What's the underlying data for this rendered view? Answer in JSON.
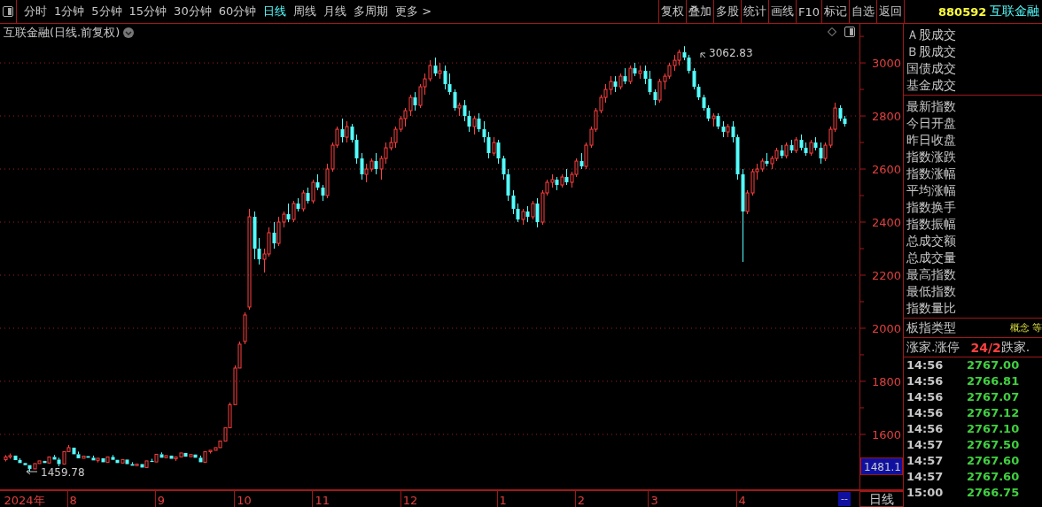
{
  "toolbar": {
    "periods": [
      {
        "label": "分时",
        "selected": false
      },
      {
        "label": "1分钟",
        "selected": false
      },
      {
        "label": "5分钟",
        "selected": false
      },
      {
        "label": "15分钟",
        "selected": false
      },
      {
        "label": "30分钟",
        "selected": false
      },
      {
        "label": "60分钟",
        "selected": false
      },
      {
        "label": "日线",
        "selected": true
      },
      {
        "label": "周线",
        "selected": false
      },
      {
        "label": "月线",
        "selected": false
      },
      {
        "label": "多周期",
        "selected": false
      },
      {
        "label": "更多 >",
        "selected": false
      }
    ],
    "buttons": [
      "复权",
      "叠加",
      "多股",
      "统计",
      "画线",
      "F10",
      "标记",
      "自选",
      "返回"
    ]
  },
  "quote": {
    "code": "880592",
    "name": "互联金融"
  },
  "chart": {
    "title": "互联金融(日线.前复权)",
    "high_label": "3062.83",
    "low_label": "1459.78",
    "last_price": "1481.1",
    "scroll_marker": "--",
    "period_button": "日线",
    "chart_data": {
      "type": "candlestick",
      "ylim": [
        1393,
        3147
      ],
      "grid": true,
      "categories": [
        null,
        null,
        null,
        null,
        "2024年",
        null,
        null,
        null,
        null,
        null,
        null,
        null,
        null,
        null,
        "8",
        null,
        null,
        null,
        null,
        null,
        null,
        null,
        null,
        null,
        null,
        null,
        null,
        null,
        null,
        null,
        null,
        null,
        "9",
        null,
        null,
        null,
        null,
        null,
        null,
        null,
        null,
        null,
        null,
        null,
        null,
        null,
        null,
        null,
        null,
        "10",
        null,
        null,
        null,
        null,
        null,
        null,
        null,
        null,
        null,
        null,
        null,
        null,
        null,
        null,
        null,
        "11",
        null,
        null,
        null,
        null,
        null,
        null,
        null,
        null,
        null,
        null,
        null,
        null,
        null,
        null,
        null,
        null,
        null,
        "12",
        null,
        null,
        null,
        null,
        null,
        null,
        null,
        null,
        null,
        null,
        null,
        null,
        null,
        null,
        null,
        null,
        null,
        null,
        "1",
        null,
        null,
        null,
        null,
        null,
        null,
        null,
        null,
        null,
        null,
        null,
        null,
        null,
        null,
        null,
        "2",
        null,
        null,
        null,
        null,
        null,
        null,
        null,
        null,
        null,
        null,
        null,
        null,
        null,
        null,
        "3",
        null,
        null,
        null,
        null,
        null,
        null,
        null,
        null,
        null,
        null,
        null,
        null,
        null,
        null,
        null,
        null,
        null,
        "4",
        null,
        null,
        null,
        null,
        null,
        null,
        null,
        null,
        null,
        null,
        null,
        null,
        null,
        null,
        null,
        null,
        null,
        null,
        null,
        null,
        null
      ],
      "yticks": [
        3000,
        2800,
        2600,
        2400,
        2200,
        2000,
        1800,
        1600
      ],
      "ohlc": [
        [
          1505,
          1522,
          1498,
          1515
        ],
        [
          1515,
          1528,
          1508,
          1520
        ],
        [
          1520,
          1524,
          1500,
          1503
        ],
        [
          1503,
          1510,
          1488,
          1492
        ],
        [
          1492,
          1498,
          1478,
          1484
        ],
        [
          1484,
          1490,
          1459,
          1470
        ],
        [
          1470,
          1495,
          1466,
          1490
        ],
        [
          1490,
          1504,
          1485,
          1500
        ],
        [
          1500,
          1506,
          1488,
          1492
        ],
        [
          1492,
          1520,
          1490,
          1515
        ],
        [
          1515,
          1522,
          1500,
          1505
        ],
        [
          1505,
          1512,
          1480,
          1488
        ],
        [
          1488,
          1540,
          1486,
          1535
        ],
        [
          1535,
          1560,
          1530,
          1550
        ],
        [
          1550,
          1556,
          1520,
          1525
        ],
        [
          1525,
          1535,
          1505,
          1510
        ],
        [
          1510,
          1522,
          1506,
          1518
        ],
        [
          1518,
          1524,
          1508,
          1512
        ],
        [
          1512,
          1520,
          1498,
          1502
        ],
        [
          1502,
          1515,
          1494,
          1510
        ],
        [
          1510,
          1514,
          1490,
          1495
        ],
        [
          1495,
          1520,
          1492,
          1515
        ],
        [
          1515,
          1522,
          1500,
          1504
        ],
        [
          1504,
          1510,
          1488,
          1492
        ],
        [
          1492,
          1508,
          1490,
          1505
        ],
        [
          1505,
          1510,
          1486,
          1488
        ],
        [
          1488,
          1495,
          1478,
          1482
        ],
        [
          1482,
          1492,
          1476,
          1488
        ],
        [
          1488,
          1494,
          1470,
          1475
        ],
        [
          1475,
          1505,
          1472,
          1500
        ],
        [
          1500,
          1508,
          1492,
          1496
        ],
        [
          1496,
          1530,
          1494,
          1525
        ],
        [
          1525,
          1532,
          1510,
          1512
        ],
        [
          1512,
          1524,
          1508,
          1520
        ],
        [
          1520,
          1524,
          1505,
          1508
        ],
        [
          1508,
          1520,
          1500,
          1515
        ],
        [
          1515,
          1535,
          1510,
          1530
        ],
        [
          1530,
          1536,
          1512,
          1516
        ],
        [
          1516,
          1528,
          1512,
          1524
        ],
        [
          1524,
          1528,
          1508,
          1512
        ],
        [
          1512,
          1520,
          1490,
          1495
        ],
        [
          1495,
          1540,
          1492,
          1535
        ],
        [
          1535,
          1545,
          1528,
          1540
        ],
        [
          1540,
          1556,
          1536,
          1550
        ],
        [
          1550,
          1580,
          1548,
          1575
        ],
        [
          1575,
          1630,
          1572,
          1625
        ],
        [
          1625,
          1720,
          1620,
          1712
        ],
        [
          1712,
          1860,
          1708,
          1850
        ],
        [
          1850,
          1950,
          1845,
          1940
        ],
        [
          1950,
          2060,
          1940,
          2050
        ],
        [
          2080,
          2450,
          2070,
          2420
        ],
        [
          2420,
          2440,
          2260,
          2300
        ],
        [
          2300,
          2340,
          2240,
          2260
        ],
        [
          2260,
          2300,
          2210,
          2280
        ],
        [
          2280,
          2380,
          2270,
          2360
        ],
        [
          2360,
          2400,
          2300,
          2320
        ],
        [
          2320,
          2420,
          2310,
          2400
        ],
        [
          2400,
          2440,
          2380,
          2430
        ],
        [
          2430,
          2470,
          2400,
          2410
        ],
        [
          2410,
          2480,
          2400,
          2470
        ],
        [
          2470,
          2490,
          2440,
          2450
        ],
        [
          2450,
          2520,
          2440,
          2510
        ],
        [
          2510,
          2530,
          2470,
          2480
        ],
        [
          2480,
          2560,
          2470,
          2550
        ],
        [
          2550,
          2580,
          2520,
          2530
        ],
        [
          2530,
          2540,
          2480,
          2500
        ],
        [
          2500,
          2620,
          2490,
          2600
        ],
        [
          2600,
          2700,
          2590,
          2690
        ],
        [
          2690,
          2760,
          2680,
          2750
        ],
        [
          2750,
          2790,
          2700,
          2720
        ],
        [
          2720,
          2780,
          2700,
          2760
        ],
        [
          2760,
          2770,
          2700,
          2710
        ],
        [
          2710,
          2730,
          2620,
          2640
        ],
        [
          2640,
          2660,
          2560,
          2580
        ],
        [
          2580,
          2620,
          2550,
          2600
        ],
        [
          2600,
          2640,
          2590,
          2630
        ],
        [
          2630,
          2660,
          2580,
          2600
        ],
        [
          2600,
          2650,
          2560,
          2640
        ],
        [
          2640,
          2700,
          2620,
          2680
        ],
        [
          2680,
          2720,
          2670,
          2700
        ],
        [
          2700,
          2760,
          2680,
          2750
        ],
        [
          2750,
          2800,
          2740,
          2790
        ],
        [
          2790,
          2830,
          2760,
          2820
        ],
        [
          2820,
          2880,
          2800,
          2870
        ],
        [
          2870,
          2890,
          2820,
          2840
        ],
        [
          2840,
          2920,
          2830,
          2910
        ],
        [
          2910,
          2960,
          2880,
          2940
        ],
        [
          2940,
          3010,
          2930,
          2990
        ],
        [
          2990,
          3020,
          2950,
          2960
        ],
        [
          2960,
          3000,
          2940,
          2970
        ],
        [
          2970,
          2990,
          2900,
          2920
        ],
        [
          2920,
          2960,
          2880,
          2890
        ],
        [
          2890,
          2900,
          2820,
          2830
        ],
        [
          2830,
          2850,
          2800,
          2840
        ],
        [
          2840,
          2860,
          2780,
          2800
        ],
        [
          2800,
          2820,
          2740,
          2760
        ],
        [
          2760,
          2800,
          2730,
          2790
        ],
        [
          2790,
          2810,
          2740,
          2750
        ],
        [
          2750,
          2780,
          2700,
          2720
        ],
        [
          2720,
          2740,
          2640,
          2660
        ],
        [
          2660,
          2720,
          2650,
          2700
        ],
        [
          2700,
          2710,
          2620,
          2640
        ],
        [
          2640,
          2650,
          2560,
          2580
        ],
        [
          2580,
          2600,
          2480,
          2500
        ],
        [
          2500,
          2520,
          2430,
          2450
        ],
        [
          2450,
          2470,
          2400,
          2410
        ],
        [
          2410,
          2450,
          2390,
          2440
        ],
        [
          2440,
          2460,
          2400,
          2420
        ],
        [
          2420,
          2480,
          2410,
          2470
        ],
        [
          2470,
          2490,
          2380,
          2400
        ],
        [
          2400,
          2520,
          2390,
          2510
        ],
        [
          2510,
          2560,
          2500,
          2550
        ],
        [
          2550,
          2580,
          2530,
          2560
        ],
        [
          2560,
          2570,
          2520,
          2540
        ],
        [
          2540,
          2580,
          2530,
          2570
        ],
        [
          2570,
          2600,
          2540,
          2550
        ],
        [
          2550,
          2590,
          2530,
          2580
        ],
        [
          2580,
          2640,
          2570,
          2630
        ],
        [
          2630,
          2660,
          2600,
          2610
        ],
        [
          2610,
          2700,
          2600,
          2690
        ],
        [
          2690,
          2760,
          2680,
          2750
        ],
        [
          2750,
          2830,
          2740,
          2820
        ],
        [
          2820,
          2880,
          2810,
          2870
        ],
        [
          2870,
          2920,
          2850,
          2900
        ],
        [
          2900,
          2950,
          2880,
          2930
        ],
        [
          2930,
          2950,
          2890,
          2910
        ],
        [
          2910,
          2960,
          2900,
          2950
        ],
        [
          2950,
          2980,
          2920,
          2930
        ],
        [
          2930,
          2990,
          2920,
          2980
        ],
        [
          2980,
          3000,
          2950,
          2960
        ],
        [
          2960,
          2990,
          2940,
          2970
        ],
        [
          2970,
          2990,
          2920,
          2940
        ],
        [
          2940,
          2970,
          2880,
          2890
        ],
        [
          2890,
          2900,
          2840,
          2860
        ],
        [
          2860,
          2940,
          2850,
          2930
        ],
        [
          2930,
          2960,
          2900,
          2950
        ],
        [
          2950,
          3000,
          2940,
          2990
        ],
        [
          2990,
          3030,
          2970,
          3010
        ],
        [
          3010,
          3050,
          2990,
          3040
        ],
        [
          3040,
          3063,
          3010,
          3020
        ],
        [
          3020,
          3030,
          2960,
          2970
        ],
        [
          2970,
          2980,
          2900,
          2910
        ],
        [
          2910,
          2920,
          2860,
          2870
        ],
        [
          2870,
          2880,
          2820,
          2830
        ],
        [
          2830,
          2840,
          2780,
          2790
        ],
        [
          2790,
          2810,
          2760,
          2800
        ],
        [
          2800,
          2810,
          2750,
          2760
        ],
        [
          2760,
          2780,
          2720,
          2740
        ],
        [
          2740,
          2770,
          2720,
          2760
        ],
        [
          2760,
          2780,
          2700,
          2720
        ],
        [
          2720,
          2730,
          2560,
          2580
        ],
        [
          2580,
          2600,
          2250,
          2440
        ],
        [
          2440,
          2520,
          2430,
          2510
        ],
        [
          2510,
          2600,
          2500,
          2590
        ],
        [
          2590,
          2620,
          2560,
          2600
        ],
        [
          2600,
          2640,
          2590,
          2630
        ],
        [
          2630,
          2660,
          2610,
          2620
        ],
        [
          2620,
          2650,
          2600,
          2640
        ],
        [
          2640,
          2680,
          2630,
          2670
        ],
        [
          2670,
          2690,
          2640,
          2650
        ],
        [
          2650,
          2700,
          2640,
          2690
        ],
        [
          2690,
          2710,
          2660,
          2670
        ],
        [
          2670,
          2720,
          2660,
          2710
        ],
        [
          2710,
          2730,
          2670,
          2680
        ],
        [
          2680,
          2700,
          2650,
          2660
        ],
        [
          2660,
          2710,
          2650,
          2700
        ],
        [
          2700,
          2720,
          2670,
          2680
        ],
        [
          2680,
          2700,
          2620,
          2640
        ],
        [
          2640,
          2700,
          2630,
          2690
        ],
        [
          2690,
          2760,
          2680,
          2750
        ],
        [
          2750,
          2850,
          2740,
          2830
        ],
        [
          2830,
          2840,
          2780,
          2790
        ],
        [
          2790,
          2800,
          2760,
          2770
        ]
      ]
    }
  },
  "panel": {
    "volume_rows": [
      "Ａ股成交",
      "Ｂ股成交",
      "国债成交",
      "基金成交"
    ],
    "index_rows": [
      "最新指数",
      "今日开盘",
      "昨日收盘",
      "指数涨跌",
      "指数涨幅",
      "平均涨幅",
      "指数换手",
      "指数振幅",
      "总成交额",
      "总成交量",
      "最高指数",
      "最低指数",
      "指数量比"
    ],
    "type_row": {
      "label": "板指类型",
      "value": "概念 等"
    },
    "breadth_row": {
      "label": "涨家.涨停",
      "value": "24/2",
      "label_2": "跌家."
    },
    "ticks": [
      {
        "time": "14:56",
        "price": "2767.00"
      },
      {
        "time": "14:56",
        "price": "2766.81"
      },
      {
        "time": "14:56",
        "price": "2767.07"
      },
      {
        "time": "14:56",
        "price": "2767.12"
      },
      {
        "time": "14:56",
        "price": "2767.10"
      },
      {
        "time": "14:57",
        "price": "2767.50"
      },
      {
        "time": "14:57",
        "price": "2767.60"
      },
      {
        "time": "14:57",
        "price": "2767.60"
      },
      {
        "time": "15:00",
        "price": "2766.75"
      }
    ]
  }
}
